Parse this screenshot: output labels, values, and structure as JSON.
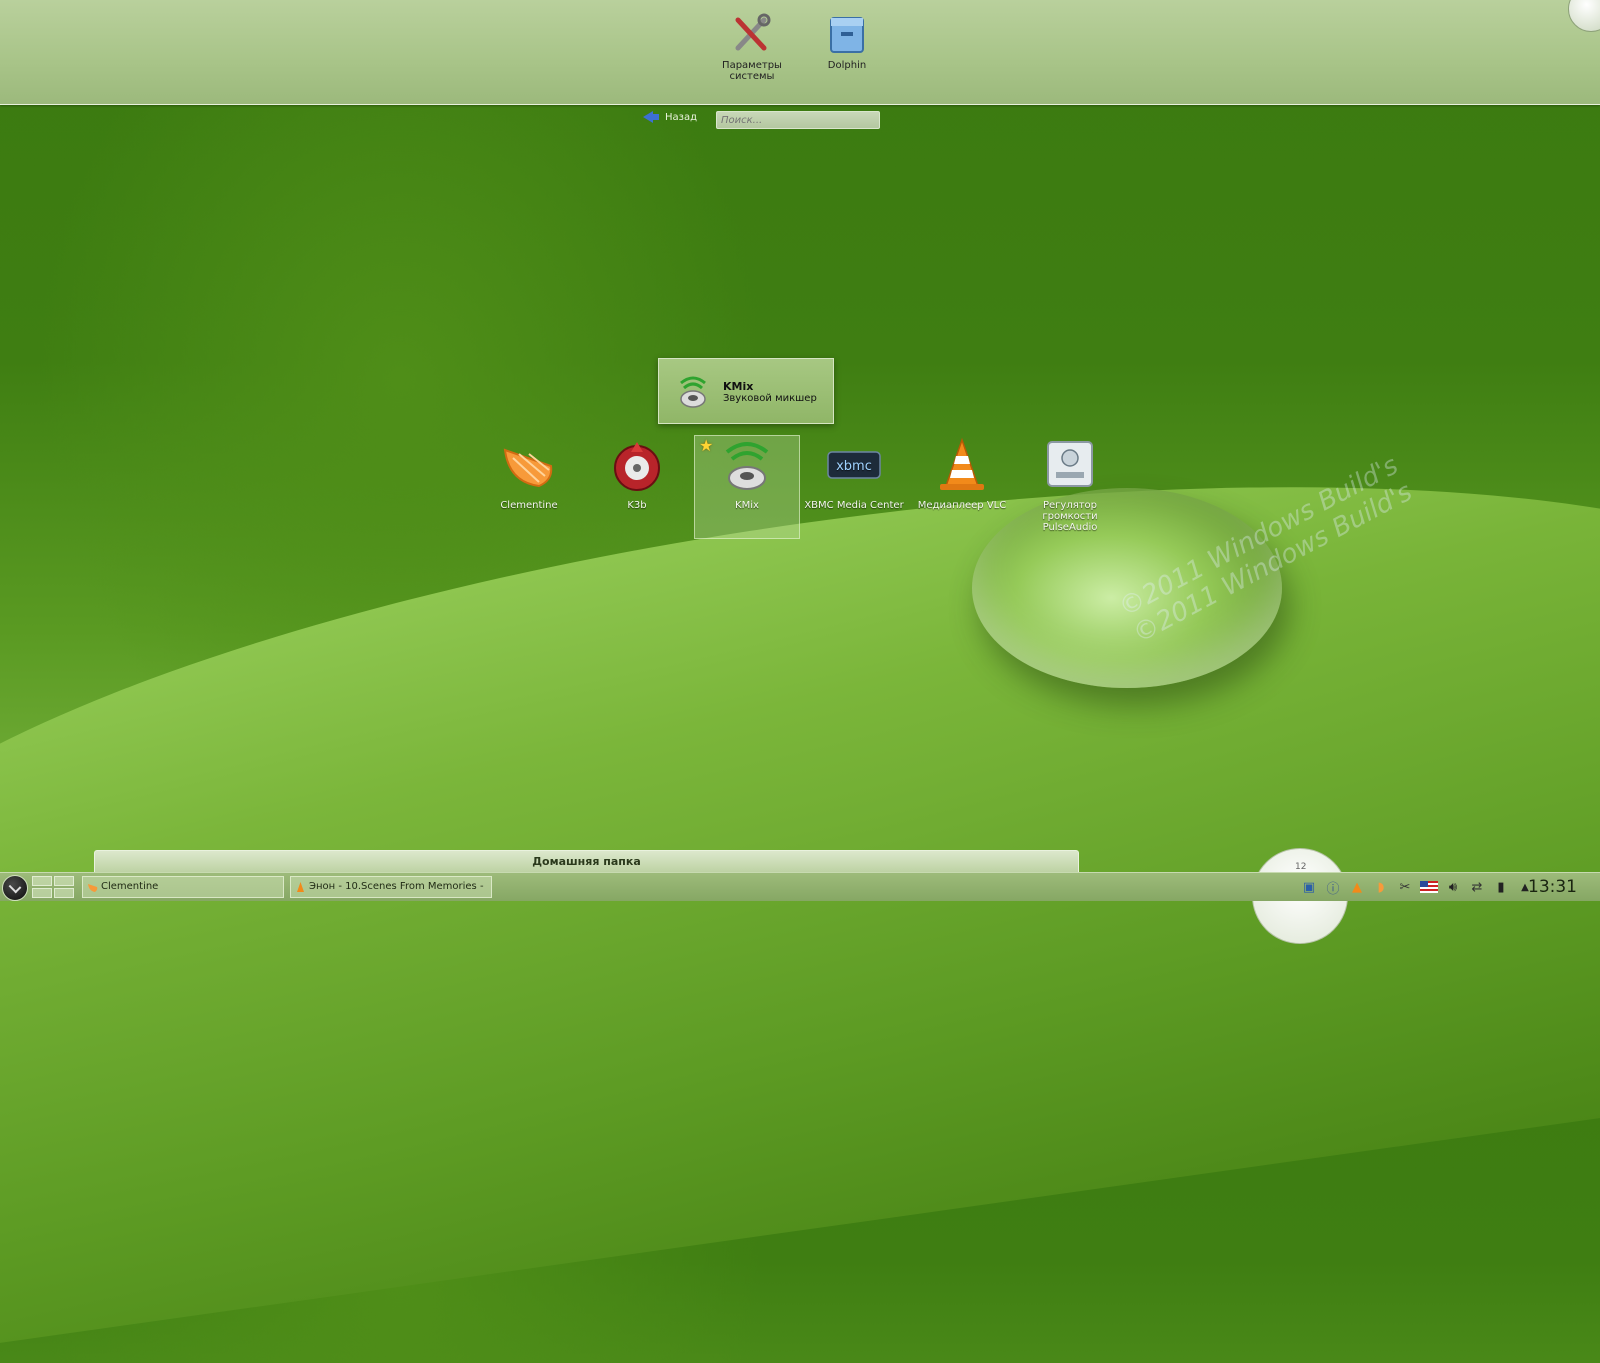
{
  "favorites": [
    {
      "label": "Параметры системы",
      "icon": "tools-icon"
    },
    {
      "label": "Dolphin",
      "icon": "file-manager-icon"
    }
  ],
  "nav": {
    "back_label": "Назад",
    "search_placeholder": "Поиск..."
  },
  "tooltip": {
    "title": "KMix",
    "subtitle": "Звуковой микшер",
    "icon": "kmix-icon"
  },
  "apps": [
    {
      "label": "Clementine",
      "icon": "clementine-icon",
      "selected": false
    },
    {
      "label": "K3b",
      "icon": "k3b-icon",
      "selected": false
    },
    {
      "label": "KMix",
      "icon": "kmix-icon",
      "selected": true,
      "favorite": true
    },
    {
      "label": "XBMC Media Center",
      "icon": "xbmc-icon",
      "selected": false
    },
    {
      "label": "Медиаплеер VLC",
      "icon": "vlc-icon",
      "selected": false
    },
    {
      "label": "Регулятор громкости PulseAudio",
      "icon": "pulseaudio-icon",
      "selected": false
    }
  ],
  "bottom": {
    "home_folder": "Домашняя папка",
    "clock_mark": "12"
  },
  "taskbar": {
    "tasks": [
      {
        "label": "Clementine",
        "icon": "clementine-icon"
      },
      {
        "label": "Энон - 10.Scenes From Memories - ",
        "icon": "vlc-icon"
      }
    ],
    "time": "13:31"
  },
  "watermark": "©2011 Windows Build's",
  "colors": {
    "accent": "#3d6fd4",
    "star": "#ffd433"
  }
}
